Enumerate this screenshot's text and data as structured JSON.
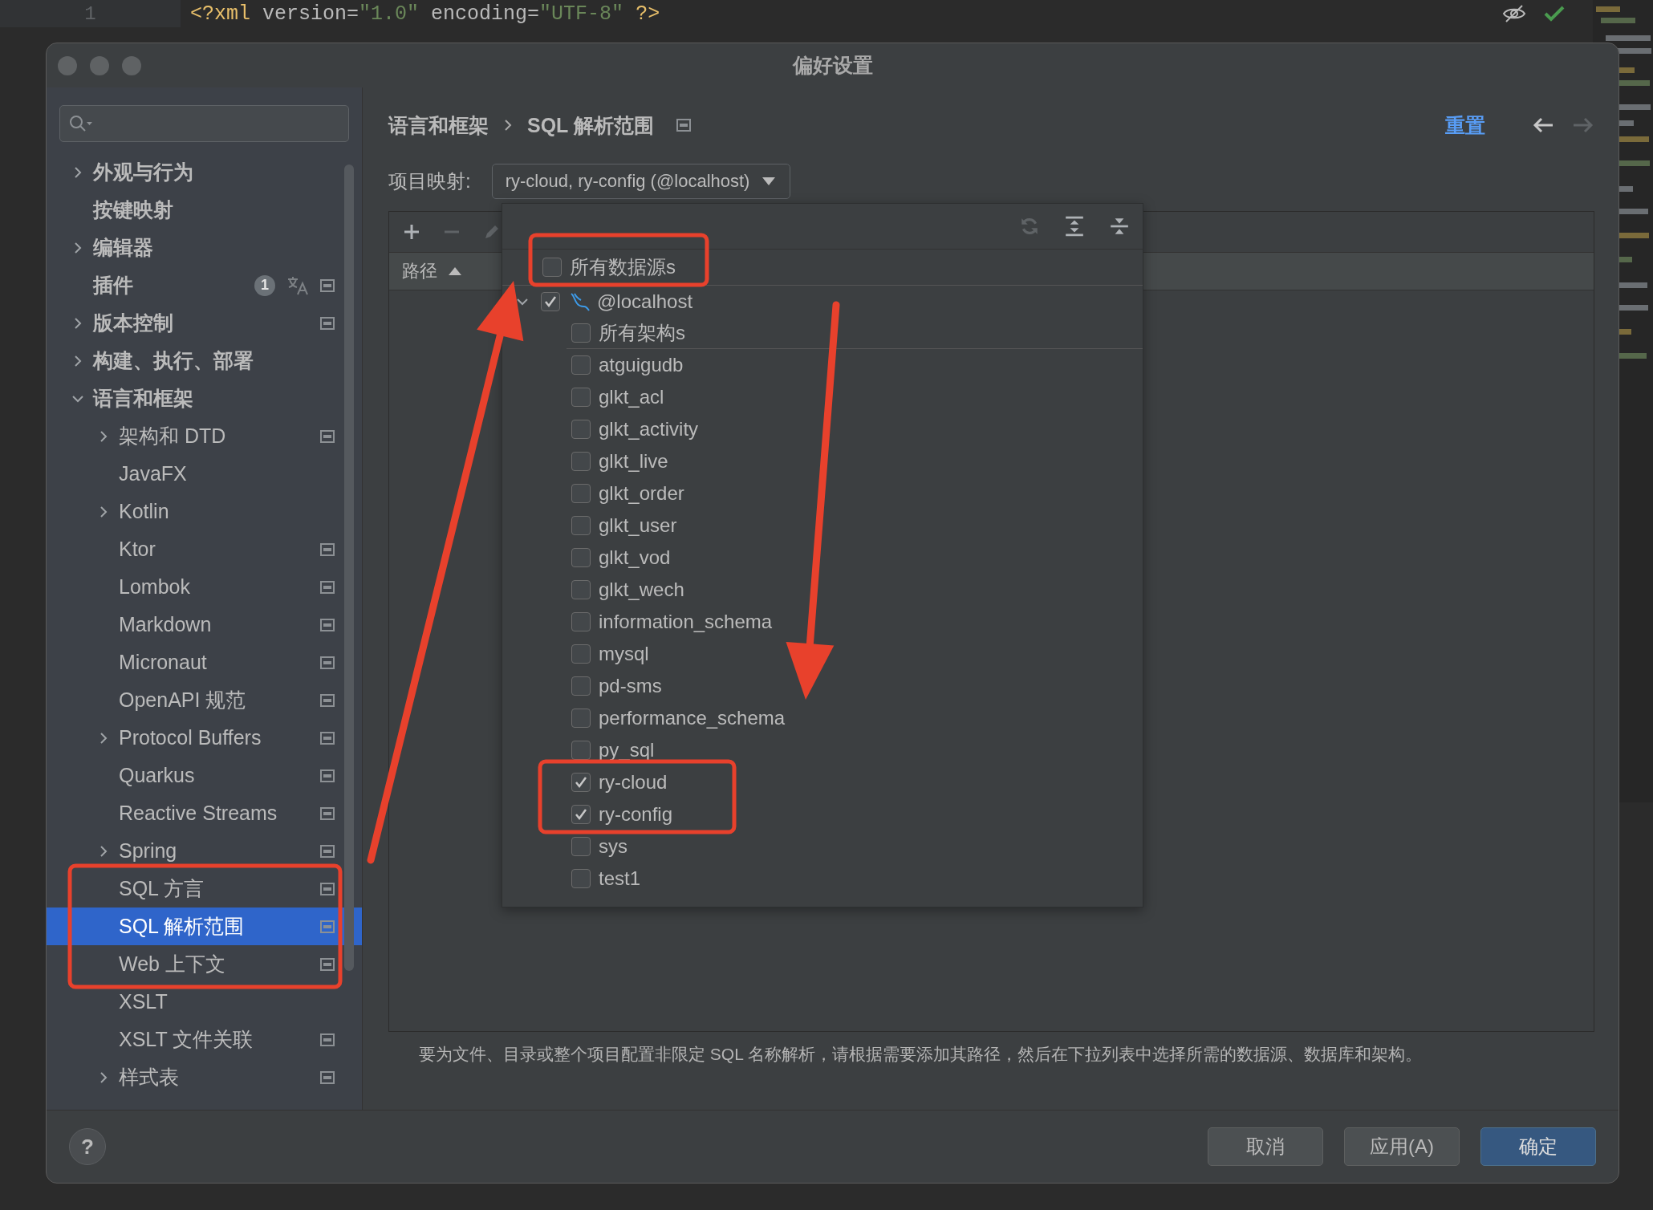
{
  "editor": {
    "line_number": "1",
    "tokens": [
      {
        "text": "<?xml ",
        "kind": "tag"
      },
      {
        "text": "version=",
        "kind": "attr"
      },
      {
        "text": "\"1.0\"",
        "kind": "string"
      },
      {
        "text": " encoding=",
        "kind": "attr"
      },
      {
        "text": "\"UTF-8\"",
        "kind": "string"
      },
      {
        "text": " ?>",
        "kind": "tag"
      }
    ]
  },
  "dialog": {
    "title": "偏好设置"
  },
  "sidebar": {
    "items": [
      {
        "label": "外观与行为",
        "expanded": false,
        "project": false,
        "selected": false
      },
      {
        "label": "按键映射",
        "project": false,
        "selected": false
      },
      {
        "label": "编辑器",
        "expanded": false,
        "project": false,
        "selected": false
      },
      {
        "label": "插件",
        "badge": "1",
        "translate": true,
        "project": true,
        "selected": false
      },
      {
        "label": "版本控制",
        "expanded": false,
        "project": true,
        "selected": false
      },
      {
        "label": "构建、执行、部署",
        "expanded": false,
        "project": false,
        "selected": false
      },
      {
        "label": "语言和框架",
        "expanded": true,
        "project": false,
        "selected": false,
        "children": [
          {
            "label": "架构和 DTD",
            "expanded": false,
            "project": true,
            "selected": false
          },
          {
            "label": "JavaFX",
            "project": false,
            "selected": false
          },
          {
            "label": "Kotlin",
            "expanded": false,
            "project": false,
            "selected": false
          },
          {
            "label": "Ktor",
            "project": true,
            "selected": false
          },
          {
            "label": "Lombok",
            "project": true,
            "selected": false
          },
          {
            "label": "Markdown",
            "project": true,
            "selected": false
          },
          {
            "label": "Micronaut",
            "project": true,
            "selected": false
          },
          {
            "label": "OpenAPI 规范",
            "project": true,
            "selected": false
          },
          {
            "label": "Protocol Buffers",
            "expanded": false,
            "project": true,
            "selected": false
          },
          {
            "label": "Quarkus",
            "project": true,
            "selected": false
          },
          {
            "label": "Reactive Streams",
            "project": true,
            "selected": false
          },
          {
            "label": "Spring",
            "expanded": false,
            "project": true,
            "selected": false
          },
          {
            "label": "SQL 方言",
            "project": true,
            "selected": false
          },
          {
            "label": "SQL 解析范围",
            "project": true,
            "selected": true
          },
          {
            "label": "Web 上下文",
            "project": true,
            "selected": false
          },
          {
            "label": "XSLT",
            "project": false,
            "selected": false
          },
          {
            "label": "XSLT 文件关联",
            "project": true,
            "selected": false
          },
          {
            "label": "样式表",
            "expanded": false,
            "project": true,
            "selected": false
          }
        ]
      }
    ]
  },
  "header": {
    "breadcrumb": [
      "语言和框架",
      "SQL 解析范围"
    ],
    "reset": "重置",
    "back_disabled": false,
    "forward_disabled": true
  },
  "mapping": {
    "label": "项目映射:",
    "value": "ry-cloud, ry-config (@localhost)"
  },
  "table": {
    "tools": [
      {
        "kind": "add",
        "disabled": false
      },
      {
        "kind": "remove",
        "disabled": true
      },
      {
        "kind": "edit",
        "disabled": true
      }
    ],
    "column": {
      "label": "路径",
      "sort_ascending": true
    }
  },
  "popup": {
    "tools": [
      {
        "kind": "refresh",
        "disabled": true
      },
      {
        "kind": "expand",
        "disabled": false
      },
      {
        "kind": "collapse",
        "disabled": false
      }
    ],
    "all_sources": {
      "label": "所有数据源s",
      "checked": false
    },
    "sources": [
      {
        "label": "@localhost",
        "checked": true,
        "expanded": true,
        "all_schemas": {
          "label": "所有架构s",
          "checked": false
        },
        "schemas": [
          {
            "label": "atguigudb",
            "checked": false
          },
          {
            "label": "glkt_acl",
            "checked": false
          },
          {
            "label": "glkt_activity",
            "checked": false
          },
          {
            "label": "glkt_live",
            "checked": false
          },
          {
            "label": "glkt_order",
            "checked": false
          },
          {
            "label": "glkt_user",
            "checked": false
          },
          {
            "label": "glkt_vod",
            "checked": false
          },
          {
            "label": "glkt_wech",
            "checked": false
          },
          {
            "label": "information_schema",
            "checked": false
          },
          {
            "label": "mysql",
            "checked": false
          },
          {
            "label": "pd-sms",
            "checked": false
          },
          {
            "label": "performance_schema",
            "checked": false
          },
          {
            "label": "py_sql",
            "checked": false
          },
          {
            "label": "ry-cloud",
            "checked": true
          },
          {
            "label": "ry-config",
            "checked": true
          },
          {
            "label": "sys",
            "checked": false
          },
          {
            "label": "test1",
            "checked": false
          }
        ]
      }
    ]
  },
  "description": "要为文件、目录或整个项目配置非限定 SQL 名称解析，请根据需要添加其路径，然后在下拉列表中选择所需的数据源、数据库和架构。",
  "help": "?",
  "buttons": [
    {
      "label": "取消",
      "kind": "normal"
    },
    {
      "label": "应用(A)",
      "kind": "normal"
    },
    {
      "label": "确定",
      "kind": "default"
    }
  ]
}
